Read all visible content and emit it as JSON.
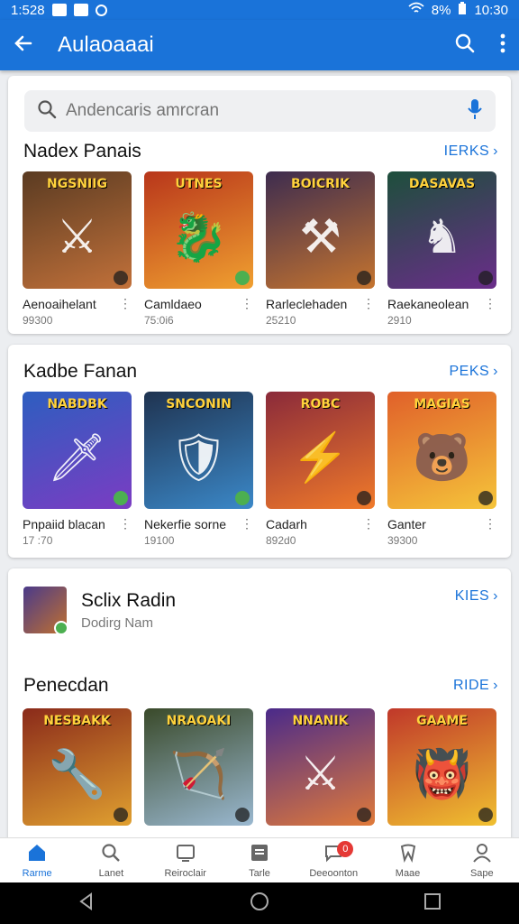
{
  "status_bar": {
    "time_left": "1:528",
    "time_right": "10:30",
    "signal_text": "8%"
  },
  "app_bar": {
    "title": "Aulaoaaai"
  },
  "search": {
    "placeholder": "Andencaris amrcran"
  },
  "sections": [
    {
      "title": "Nadex Panais",
      "more": "IERKS",
      "items": [
        {
          "name": "Aenoaihelant",
          "sub": "99300",
          "banner": "NGSNIIG",
          "colors": [
            "#5a3b22",
            "#c2713a"
          ],
          "glyph": "⚔",
          "badge": "dark"
        },
        {
          "name": "Camldaeo",
          "sub": "75:0i6",
          "banner": "UTNES",
          "colors": [
            "#b8361b",
            "#f0a030"
          ],
          "glyph": "🐉",
          "badge": "green"
        },
        {
          "name": "Rarleclehaden",
          "sub": "25210",
          "banner": "BOICRIK",
          "colors": [
            "#3d2c4f",
            "#c5742f"
          ],
          "glyph": "⚒",
          "badge": "dark"
        },
        {
          "name": "Raekaneolean",
          "sub": "2910",
          "banner": "DASAVAS",
          "colors": [
            "#1d4f3b",
            "#6a2d8a"
          ],
          "glyph": "♞",
          "badge": "dark"
        }
      ]
    },
    {
      "title": "Kadbe Fanan",
      "more": "PEKS",
      "items": [
        {
          "name": "Pnpaiid blacan",
          "sub": "17 :70",
          "banner": "NABDBK",
          "colors": [
            "#2d5ec0",
            "#7b3cc2"
          ],
          "glyph": "🗡",
          "badge": "green"
        },
        {
          "name": "Nekerfie sorne",
          "sub": "19100",
          "banner": "SNCONIN",
          "colors": [
            "#1f3350",
            "#3b88c8"
          ],
          "glyph": "🛡",
          "badge": "green"
        },
        {
          "name": "Cadarh",
          "sub": "892d0",
          "banner": "ROBC",
          "colors": [
            "#8a2a3a",
            "#f07a2a"
          ],
          "glyph": "⚡",
          "badge": "dark"
        },
        {
          "name": "Ganter",
          "sub": "39300",
          "banner": "MAGIAS",
          "colors": [
            "#e0602a",
            "#f5c43a"
          ],
          "glyph": "🐻",
          "badge": "dark"
        }
      ]
    }
  ],
  "feature": {
    "title": "Sclix Radin",
    "subtitle": "Dodirg Nam",
    "more": "KIES"
  },
  "section3": {
    "title": "Penecdan",
    "more": "RIDE",
    "items": [
      {
        "banner": "NESBAKK",
        "colors": [
          "#8a2a1a",
          "#e0a030"
        ],
        "glyph": "🔧",
        "badge": "dark"
      },
      {
        "banner": "NRAOAKI",
        "colors": [
          "#3a4a2a",
          "#9ab8d0"
        ],
        "glyph": "🏹",
        "badge": "dark"
      },
      {
        "banner": "NNANIK",
        "colors": [
          "#4a2a8a",
          "#e07a3a"
        ],
        "glyph": "⚔",
        "badge": "dark"
      },
      {
        "banner": "GAAME",
        "colors": [
          "#c0382a",
          "#f0c030"
        ],
        "glyph": "👹",
        "badge": "dark"
      }
    ]
  },
  "bottom_nav": [
    {
      "label": "Rarme",
      "icon": "home-icon",
      "active": true
    },
    {
      "label": "Lanet",
      "icon": "search-icon",
      "active": false
    },
    {
      "label": "Reiroclair",
      "icon": "tv-icon",
      "active": false
    },
    {
      "label": "Tarle",
      "icon": "list-icon",
      "active": false
    },
    {
      "label": "Deeoonton",
      "icon": "chat-icon",
      "active": false,
      "badge": "0"
    },
    {
      "label": "Maae",
      "icon": "tooth-icon",
      "active": false
    },
    {
      "label": "Sape",
      "icon": "user-icon",
      "active": false
    }
  ],
  "colors": {
    "brand": "#1a73d9",
    "background": "#eceef1"
  }
}
